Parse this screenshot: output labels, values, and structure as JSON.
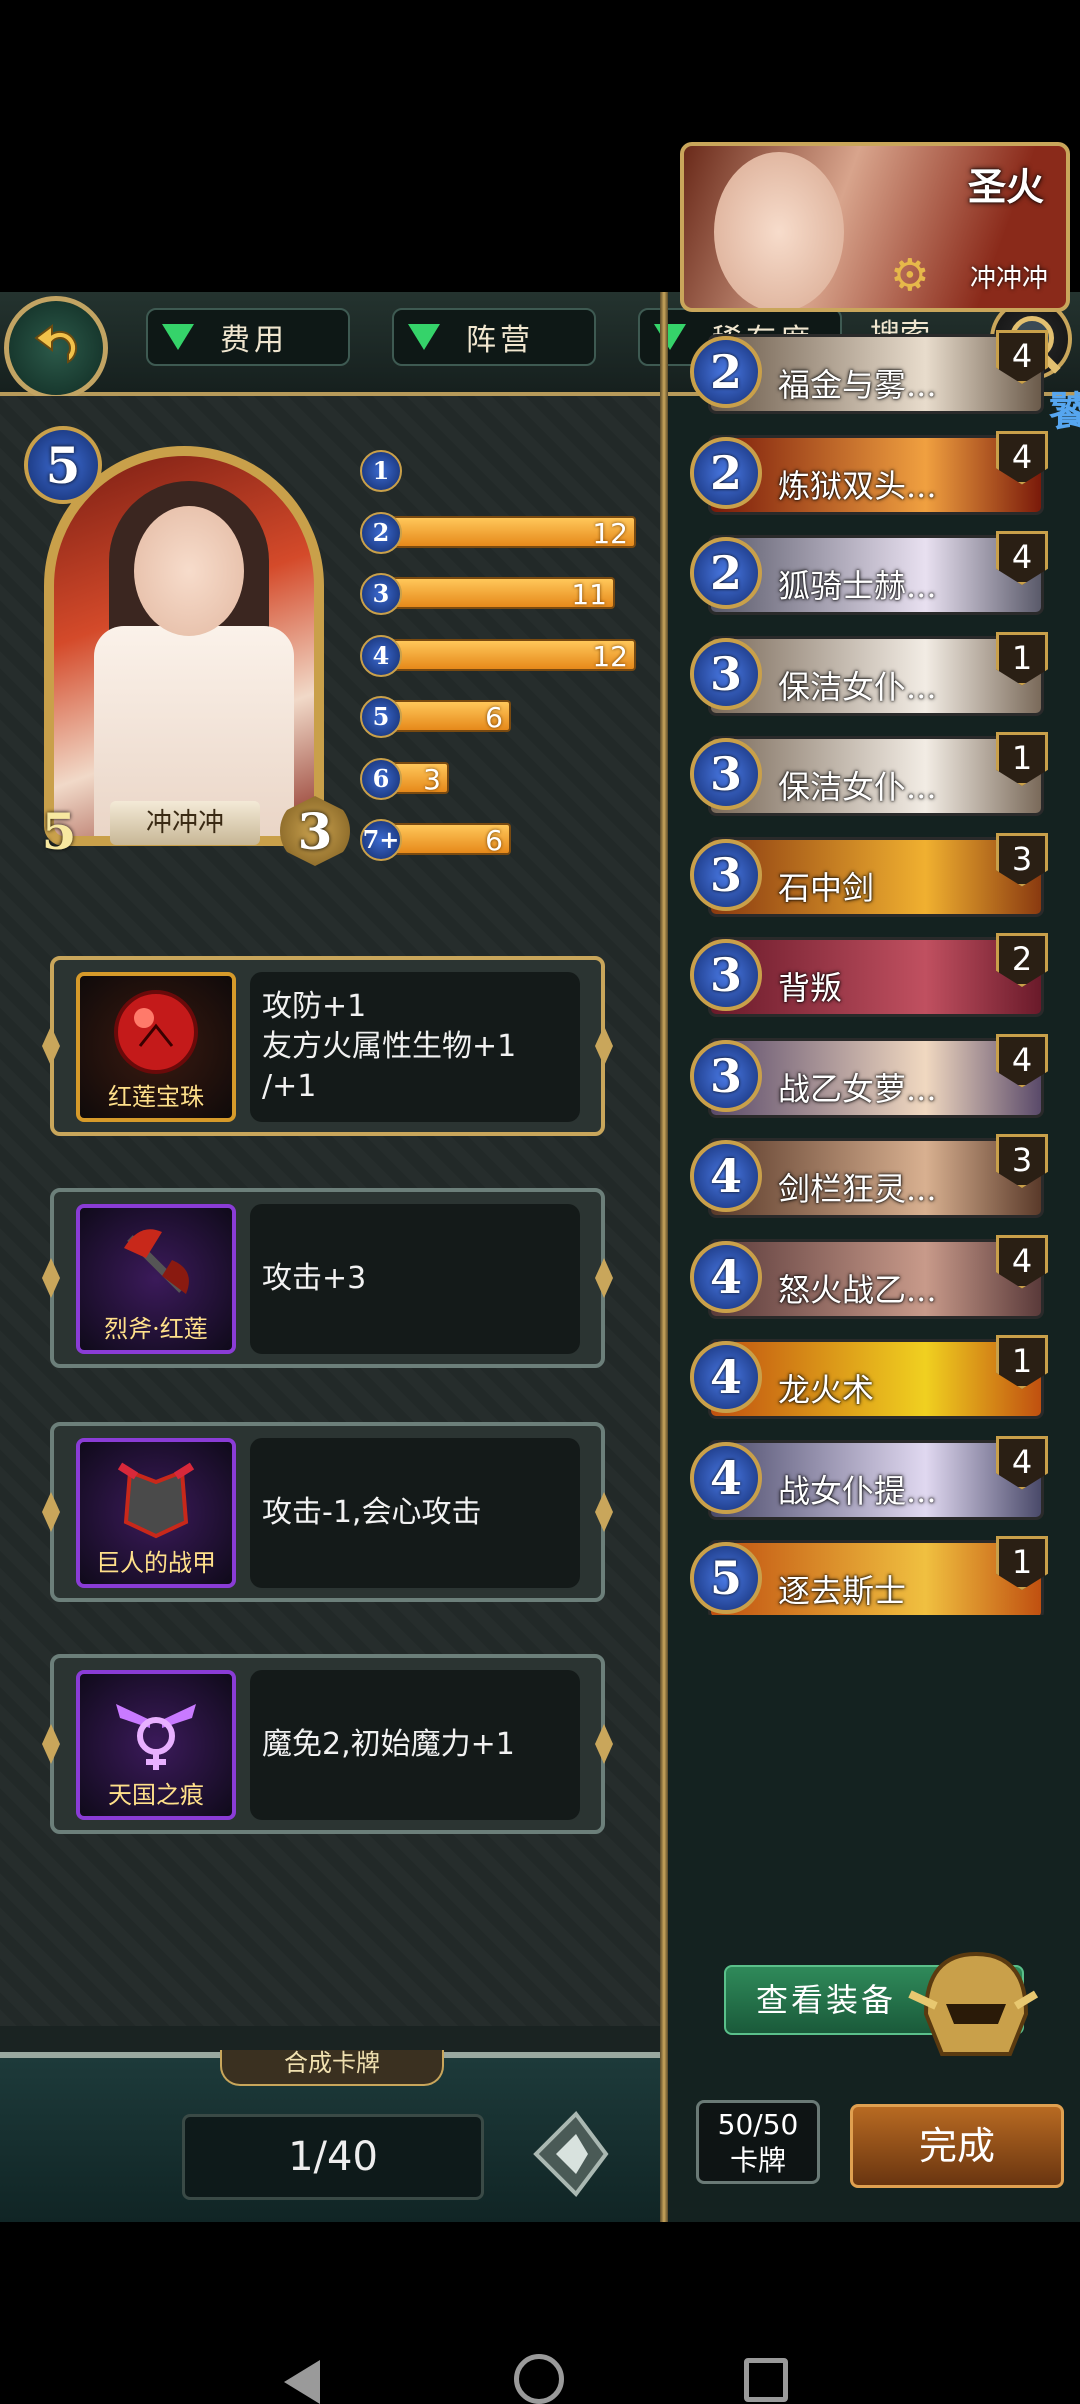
{
  "topbar": {
    "filters": [
      "费用",
      "阵营",
      "稀有度"
    ],
    "search_label": "搜索"
  },
  "side_tab": "饕",
  "hero": {
    "name": "冲冲冲",
    "cost": "5",
    "attack": "5",
    "health": "3"
  },
  "mana_curve": [
    {
      "cost": "1",
      "count": ""
    },
    {
      "cost": "2",
      "count": "12"
    },
    {
      "cost": "3",
      "count": "11"
    },
    {
      "cost": "4",
      "count": "12"
    },
    {
      "cost": "5",
      "count": "6"
    },
    {
      "cost": "6",
      "count": "3"
    },
    {
      "cost": "7+",
      "count": "6"
    }
  ],
  "curve_values": [
    0,
    12,
    11,
    12,
    6,
    3,
    6
  ],
  "equipment": [
    {
      "name": "红莲宝珠",
      "desc": "攻防+1\n友方火属性生物+1\n/+1",
      "icon": "red-orb-icon"
    },
    {
      "name": "烈斧·红莲",
      "desc": "攻击+3",
      "icon": "axe-icon"
    },
    {
      "name": "巨人的战甲",
      "desc": "攻击-1,会心攻击",
      "icon": "armor-icon"
    },
    {
      "name": "天国之痕",
      "desc": "魔免2,初始魔力+1",
      "icon": "wing-emblem-icon"
    }
  ],
  "synth_label": "合成卡牌",
  "pager": "1/40",
  "deck": {
    "title": "圣火",
    "owner": "冲冲冲",
    "cards": [
      {
        "cost": "2",
        "name": "福金与雾...",
        "qty": "4"
      },
      {
        "cost": "2",
        "name": "炼狱双头...",
        "qty": "4"
      },
      {
        "cost": "2",
        "name": "狐骑士赫...",
        "qty": "4"
      },
      {
        "cost": "3",
        "name": "保洁女仆...",
        "qty": "1"
      },
      {
        "cost": "3",
        "name": "保洁女仆...",
        "qty": "1"
      },
      {
        "cost": "3",
        "name": "石中剑",
        "qty": "3"
      },
      {
        "cost": "3",
        "name": "背叛",
        "qty": "2"
      },
      {
        "cost": "3",
        "name": "战乙女萝...",
        "qty": "4"
      },
      {
        "cost": "4",
        "name": "剑栏狂灵...",
        "qty": "3"
      },
      {
        "cost": "4",
        "name": "怒火战乙...",
        "qty": "4"
      },
      {
        "cost": "4",
        "name": "龙火术",
        "qty": "1"
      },
      {
        "cost": "4",
        "name": "战女仆提...",
        "qty": "4"
      },
      {
        "cost": "5",
        "name": "逐去斯士",
        "qty": "1"
      }
    ]
  },
  "view_equipment": "查看装备",
  "card_count": {
    "value": "50/50",
    "label": "卡牌"
  },
  "done": "完成",
  "colors": {
    "accent_gold": "#c9a65b",
    "bar_orange": "#f0a030",
    "gem_blue": "#3f6ed6"
  }
}
